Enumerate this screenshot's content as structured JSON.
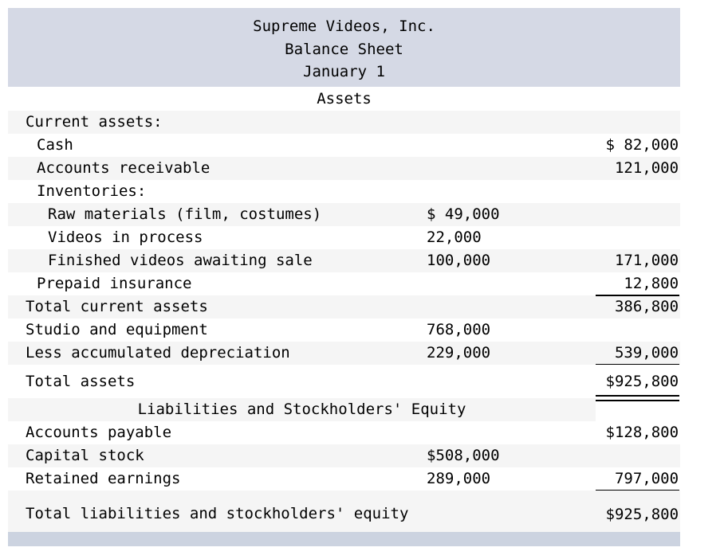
{
  "document": {
    "company": "Supreme Videos, Inc.",
    "statement": "Balance Sheet",
    "date": "January 1"
  },
  "sections": {
    "assets_heading": "Assets",
    "liabilities_heading": "Liabilities and Stockholders' Equity"
  },
  "assets": {
    "current_assets_heading": "Current assets:",
    "cash_label": "Cash",
    "cash_value": "$ 82,000",
    "accounts_receivable_label": "Accounts receivable",
    "accounts_receivable_value": "121,000",
    "inventories_heading": "Inventories:",
    "raw_materials_label": "Raw materials (film, costumes)",
    "raw_materials_value": "$ 49,000",
    "videos_in_process_label": "Videos in process",
    "videos_in_process_value": "22,000",
    "finished_videos_label": "Finished videos awaiting sale",
    "finished_videos_value": "100,000",
    "inventories_total_value": "171,000",
    "prepaid_insurance_label": "Prepaid insurance",
    "prepaid_insurance_value": "12,800",
    "total_current_assets_label": "Total current assets",
    "total_current_assets_value": "386,800",
    "studio_equipment_label": "Studio and equipment",
    "studio_equipment_value": "768,000",
    "accumulated_depreciation_label": "Less accumulated depreciation",
    "accumulated_depreciation_value": "229,000",
    "net_studio_equipment_value": "539,000",
    "total_assets_label": "Total assets",
    "total_assets_value": "$925,800"
  },
  "liabilities_equity": {
    "accounts_payable_label": "Accounts payable",
    "accounts_payable_value": "$128,800",
    "capital_stock_label": "Capital stock",
    "capital_stock_value": "$508,000",
    "retained_earnings_label": "Retained earnings",
    "retained_earnings_value": "289,000",
    "total_equity_value": "797,000",
    "total_liabilities_equity_label": "Total liabilities and stockholders' equity",
    "total_liabilities_equity_value": "$925,800"
  },
  "colors": {
    "header_band": "#d5d9e5",
    "footer_band": "#ccd3e0",
    "row_stripe": "#f5f5f5",
    "row_plain": "#ffffff",
    "text": "#000000"
  }
}
